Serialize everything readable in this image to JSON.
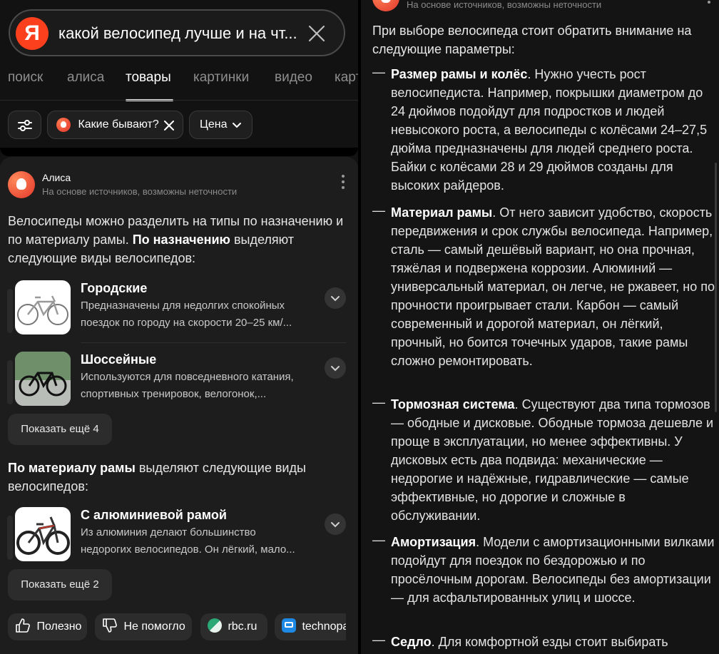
{
  "search": {
    "logo": "Я",
    "query": "какой велосипед лучше и на чт..."
  },
  "tabs": [
    "поиск",
    "алиса",
    "товары",
    "картинки",
    "видео",
    "карт"
  ],
  "filters": {
    "chip_label": "Какие бывают?",
    "price_label": "Цена"
  },
  "answer": {
    "source_name": "Алиса",
    "disclaimer": "На основе источников, возможны неточности",
    "intro_plain": "Велосипеды можно разделить на типы по назначению и по материалу рамы.",
    "intro_bold": "По назначению",
    "intro_rest": "выделяют следующие виды велосипедов:",
    "purpose_items": [
      {
        "title": "Городские",
        "line1": "Предназначены для недолгих спокойных",
        "line2": "поездок по городу на скорости 20–25 км/..."
      },
      {
        "title": "Шоссейные",
        "line1": "Используются для повседневного катания,",
        "line2": "спортивных тренировок, велогонок,..."
      }
    ],
    "show_more_1": "Показать ещё 4",
    "material_bold": "По материалу рамы",
    "material_rest": "выделяют следующие виды велосипедов:",
    "material_items": [
      {
        "title": "С алюминиевой рамой",
        "line1": "Из алюминия делают большинство",
        "line2": "недорогих велосипедов. Он лёгкий, мало..."
      }
    ],
    "show_more_2": "Показать ещё 2",
    "feedback": {
      "useful": "Полезно",
      "not_helpful": "Не помогло",
      "source1": "rbc.ru",
      "source2": "technopa"
    }
  },
  "right": {
    "disclaimer": "На основе источников, возможны неточности",
    "intro": "При выборе велосипеда стоит обратить внимание на следующие параметры:",
    "items": [
      {
        "bold": "Размер рамы и колёс",
        "text": ". Нужно учесть рост велосипедиста. Например, покрышки диаметром до 24 дюймов подойдут для подростков и людей невысокого роста, а велосипеды с колёсами 24–27,5 дюйма предназначены для людей среднего роста. Байки с колёсами 28 и 29 дюймов созданы для высоких райдеров."
      },
      {
        "bold": "Материал рамы",
        "text": ". От него зависит удобство, скорость передвижения и срок службы велосипеда. Например, сталь — самый дешёвый вариант, но она прочная, тяжёлая и подвержена коррозии. Алюминий — универсальный материал, он легче, не ржавеет, но по прочности проигрывает стали. Карбон — самый современный и дорогой материал, он лёгкий, прочный, но боится точечных ударов, такие рамы сложно ремонтировать."
      },
      {
        "bold": "Тормозная система",
        "text": ". Существуют два типа тормозов — ободные и дисковые. Ободные тормоза дешевле и проще в эксплуатации, но менее эффективны. У дисковых есть два подвида: механические — недорогие и надёжные, гидравлические — самые эффективные, но дорогие и сложные в обслуживании."
      },
      {
        "bold": "Амортизация",
        "text": ". Модели с амортизационными вилками подойдут для поездок по бездорожью и по просёлочным дорогам. Велосипеды без амортизации — для асфальтированных улиц и шоссе."
      },
      {
        "bold": "Седло",
        "text": ". Для комфортной езды стоит выбирать"
      }
    ],
    "dash": "—"
  }
}
